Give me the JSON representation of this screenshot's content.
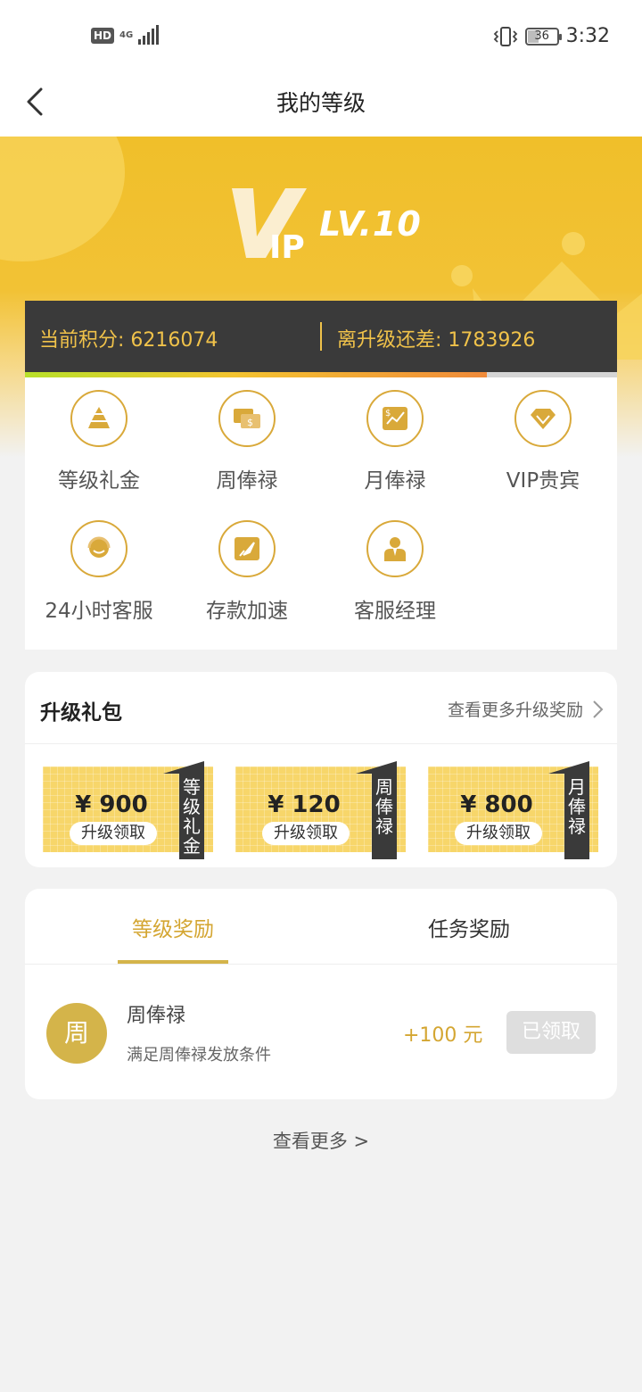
{
  "status_bar": {
    "left": {
      "hd": "HD",
      "network": "4G"
    },
    "battery": "36",
    "time": "3:32"
  },
  "nav": {
    "title": "我的等级",
    "back_icon": "back-chevron-icon"
  },
  "banner": {
    "vip_logo": "VIP",
    "level": "LV.10"
  },
  "points": {
    "current": "当前积分: 6216074",
    "diff": "离升级还差: 1783926",
    "progress": 0.78
  },
  "features": [
    {
      "label": "等级礼金",
      "icon": "pyramid-icon"
    },
    {
      "label": "周俸禄",
      "icon": "money-chat-icon"
    },
    {
      "label": "月俸禄",
      "icon": "chart-dollar-icon"
    },
    {
      "label": "VIP贵宾",
      "icon": "diamond-icon"
    },
    {
      "label": "24小时客服",
      "icon": "headset-icon"
    },
    {
      "label": "存款加速",
      "icon": "rocket-icon"
    },
    {
      "label": "客服经理",
      "icon": "manager-icon"
    }
  ],
  "upgrade_package": {
    "title": "升级礼包",
    "more_label": "查看更多升级奖励",
    "vouchers": [
      {
        "amount": "¥ 900",
        "action": "升级领取",
        "tag": "等级礼金"
      },
      {
        "amount": "¥ 120",
        "action": "升级领取",
        "tag": "周俸禄"
      },
      {
        "amount": "¥ 800",
        "action": "升级领取",
        "tag": "月俸禄"
      }
    ]
  },
  "rewards": {
    "tabs": [
      "等级奖励",
      "任务奖励"
    ],
    "active_tab": 0,
    "items": [
      {
        "avatar_char": "周",
        "name": "周俸禄",
        "desc": "满足周俸禄发放条件",
        "amount": "+100 元",
        "button": "已领取"
      }
    ]
  },
  "see_more": "查看更多 >",
  "colors": {
    "gold": "#d4a632",
    "banner": "#f0bf2a",
    "dark": "#3a3a3a"
  }
}
